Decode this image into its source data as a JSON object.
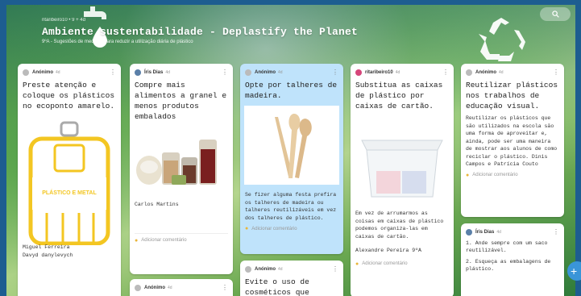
{
  "board": {
    "author_line": "ritaribeiro10 • 9 + 4d",
    "title": "Ambiente   sustentabilidade - Deplastify the Planet",
    "subtitle": "9ºA - Sugestões de medidas para reduzir a utilização diária de plástico"
  },
  "posts": [
    {
      "author": "Anónimo",
      "time": "4d",
      "title": "Preste atenção e coloque os plásticos no ecoponto amarelo.",
      "image_label": "PLÁSTICO E METAL",
      "body": "Miguel Ferreira\nDavyd danylevych"
    },
    {
      "author": "Íris Dias",
      "time": "4d",
      "title": "Compre mais alimentos a granel e menos produtos embalados",
      "body": "Carlos Martins",
      "comment": "Adicionar comentário"
    },
    {
      "author": "Anónimo",
      "time": "4d",
      "title": "Opte por talheres de madeira.",
      "body": "Se fizer alguma festa prefira os talheres de madeira ou talheres reutilizáveis em vez dos talheres de plástico.",
      "comment": "Adicionar comentário"
    },
    {
      "author": "ritaribeiro10",
      "time": "4d",
      "title": "Substitua as caixas de plástico por caixas de cartão.",
      "body": "Em vez de arrumarmos as coisas em caixas de plástico podemos organiza-las em caixas de cartão.",
      "signature": "Alexandre Pereira 9ºA",
      "comment": "Adicionar comentário"
    },
    {
      "author": "Anónimo",
      "time": "4d",
      "title": "Reutilizar plásticos nos trabalhos de educação visual.",
      "body": "Reutilizar os plásticos que são utilizados na escola são uma forma de aproveitar e, ainda, pode ser uma maneira de mostrar aos alunos de como reciclar o plástico. Dinis Campos e Patrícia Couto",
      "comment": "Adicionar comentário"
    },
    {
      "author": "Anónimo",
      "time": "4d",
      "title": ""
    },
    {
      "author": "Anónimo",
      "time": "4d",
      "title": "Evite o uso de cosméticos que"
    },
    {
      "author": "Íris Dias",
      "time": "4d",
      "items": [
        "1. Ande sempre com um saco reutilizável.",
        "2. Esqueça as embalagens de plástico."
      ]
    }
  ]
}
